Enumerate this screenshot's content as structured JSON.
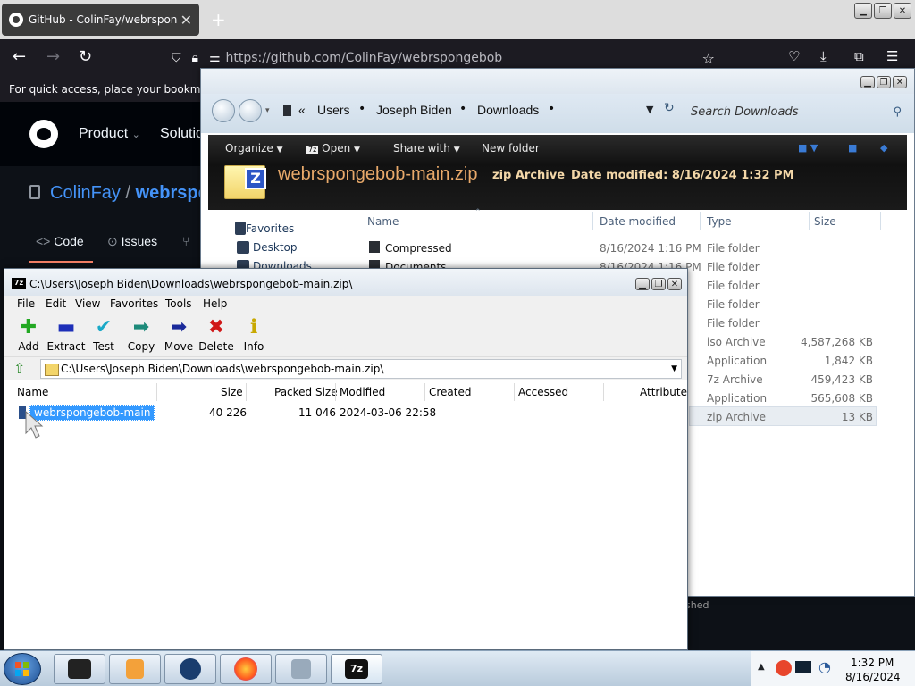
{
  "browser": {
    "tab_title": "GitHub - ColinFay/webrspongebob",
    "url": "https://github.com/ColinFay/webrspongebob",
    "bookmarks_hint": "For quick access, place your bookmarks h",
    "nav": {
      "product": "Product",
      "solutions": "Solutio"
    },
    "repo": {
      "owner": "ColinFay",
      "sep": "/",
      "name": "webrspo"
    },
    "repo_tabs": {
      "code": "Code",
      "issues": "Issues"
    }
  },
  "explorer": {
    "breadcrumb": [
      "Users",
      "Joseph Biden",
      "Downloads"
    ],
    "search_placeholder": "Search Downloads",
    "toolbar": {
      "organize": "Organize",
      "open": "Open",
      "share": "Share with",
      "new_folder": "New folder"
    },
    "file": {
      "title": "webrspongebob-main.zip",
      "kind": "zip Archive",
      "date_label": "Date modified:",
      "date": "8/16/2024 1:32 PM"
    },
    "columns": {
      "name": "Name",
      "date": "Date modified",
      "type": "Type",
      "size": "Size"
    },
    "favorites": "Favorites",
    "nav_items": [
      "Desktop",
      "Downloads"
    ],
    "rows": [
      {
        "name": "Compressed",
        "date": "8/16/2024 1:16 PM",
        "type": "File folder",
        "size": ""
      },
      {
        "name": "Documents",
        "date": "8/16/2024 1:16 PM",
        "type": "File folder",
        "size": ""
      },
      {
        "name": "",
        "date": "",
        "type": "File folder",
        "size": ""
      },
      {
        "name": "",
        "date": "",
        "type": "File folder",
        "size": ""
      },
      {
        "name": "",
        "date": "",
        "type": "File folder",
        "size": ""
      },
      {
        "name": "",
        "date": "",
        "type": "iso Archive",
        "size": "4,587,268 KB"
      },
      {
        "name": "",
        "date": "",
        "type": "Application",
        "size": "1,842 KB"
      },
      {
        "name": "",
        "date": "",
        "type": "7z Archive",
        "size": "459,423 KB"
      },
      {
        "name": "",
        "date": "",
        "type": "Application",
        "size": "565,608 KB"
      },
      {
        "name": "",
        "date": "",
        "type": "zip Archive",
        "size": "13 KB"
      }
    ],
    "status_fragment": "shed"
  },
  "sevenzip": {
    "title": "C:\\Users\\Joseph Biden\\Downloads\\webrspongebob-main.zip\\",
    "menu": [
      "File",
      "Edit",
      "View",
      "Favorites",
      "Tools",
      "Help"
    ],
    "tools": [
      {
        "label": "Add",
        "icon": "plus-icon",
        "color": "#22a822"
      },
      {
        "label": "Extract",
        "icon": "minus-icon",
        "color": "#1d2fb8"
      },
      {
        "label": "Test",
        "icon": "check-icon",
        "color": "#1aa9c7"
      },
      {
        "label": "Copy",
        "icon": "copy-arrow-icon",
        "color": "#1d8a7a"
      },
      {
        "label": "Move",
        "icon": "move-arrow-icon",
        "color": "#1a2a9a"
      },
      {
        "label": "Delete",
        "icon": "delete-x-icon",
        "color": "#d01818"
      },
      {
        "label": "Info",
        "icon": "info-icon",
        "color": "#c8a800"
      }
    ],
    "path": "C:\\Users\\Joseph Biden\\Downloads\\webrspongebob-main.zip\\",
    "columns": [
      "Name",
      "Size",
      "Packed Size",
      "Modified",
      "Created",
      "Accessed",
      "Attribute"
    ],
    "row": {
      "name": "webrspongebob-main",
      "size": "40 226",
      "packed": "11 046",
      "modified": "2024-03-06 22:58"
    }
  },
  "taskbar": {
    "time": "1:32 PM",
    "date": "8/16/2024"
  }
}
